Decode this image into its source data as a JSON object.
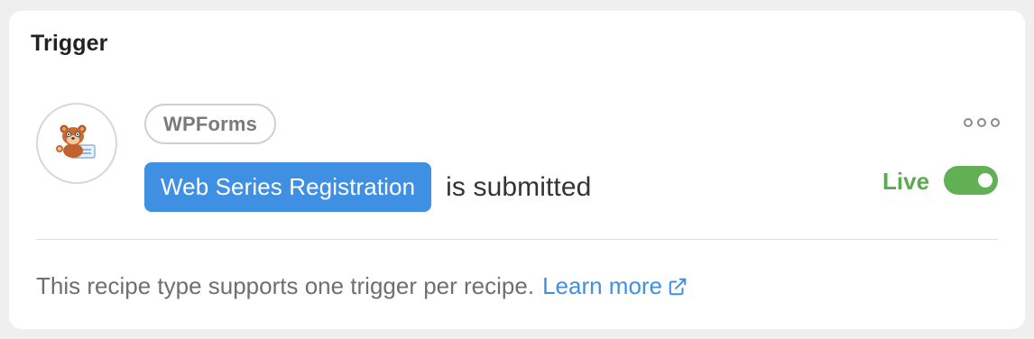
{
  "section": {
    "title": "Trigger"
  },
  "trigger": {
    "integration": "WPForms",
    "integration_icon": "wpforms-bear-logo",
    "token": "Web Series Registration",
    "condition_text": "is submitted",
    "status_label": "Live",
    "status_on": true,
    "menu_icon": "more-options-icon"
  },
  "footer": {
    "note": "This recipe type supports one trigger per recipe.",
    "link_label": "Learn more",
    "link_icon": "external-link-icon"
  },
  "colors": {
    "token_bg": "#3f8fe3",
    "live_green": "#5aab4f",
    "toggle_green": "#62b054",
    "link_blue": "#3f8fe3"
  }
}
